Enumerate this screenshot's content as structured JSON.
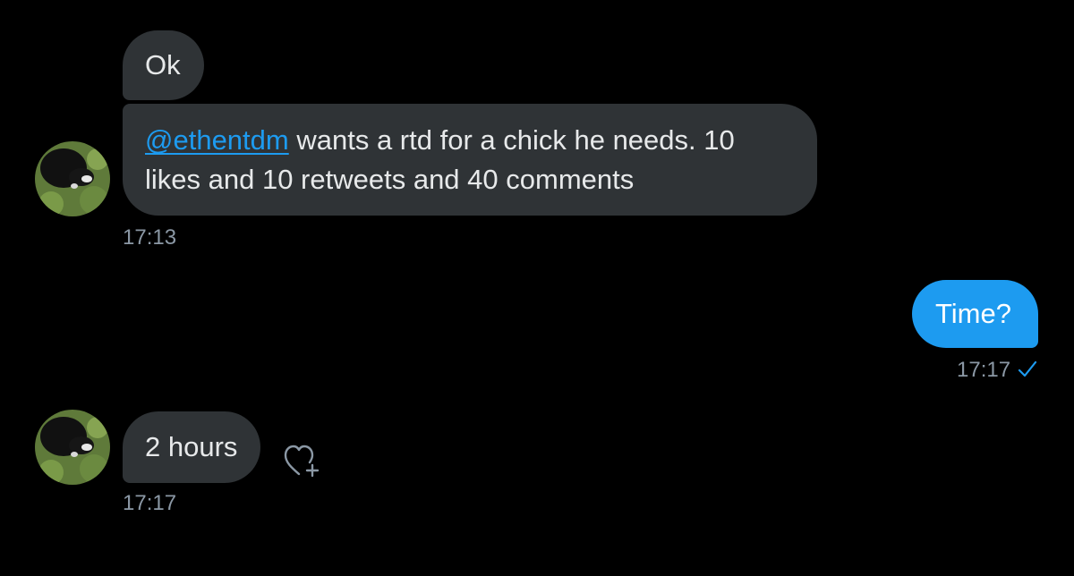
{
  "conversation": {
    "messages": [
      {
        "direction": "incoming",
        "text": "Ok"
      },
      {
        "direction": "incoming",
        "mention": "@ethentdm",
        "line1_rest": " wants a rtd for a chick he needs. 10",
        "line2": "likes and 10 retweets and 40 comments",
        "time": "17:13"
      },
      {
        "direction": "outgoing",
        "text": "Time?",
        "time": "17:17",
        "status_icon": "checkmark-icon"
      },
      {
        "direction": "incoming",
        "text": "2 hours",
        "time": "17:17",
        "reaction_icon": "heart-plus-icon"
      }
    ]
  },
  "colors": {
    "background": "#000000",
    "incoming_bubble": "#2f3336",
    "outgoing_bubble": "#1d9bf0",
    "mention": "#1d9bf0",
    "timestamp": "#8b98a5"
  }
}
